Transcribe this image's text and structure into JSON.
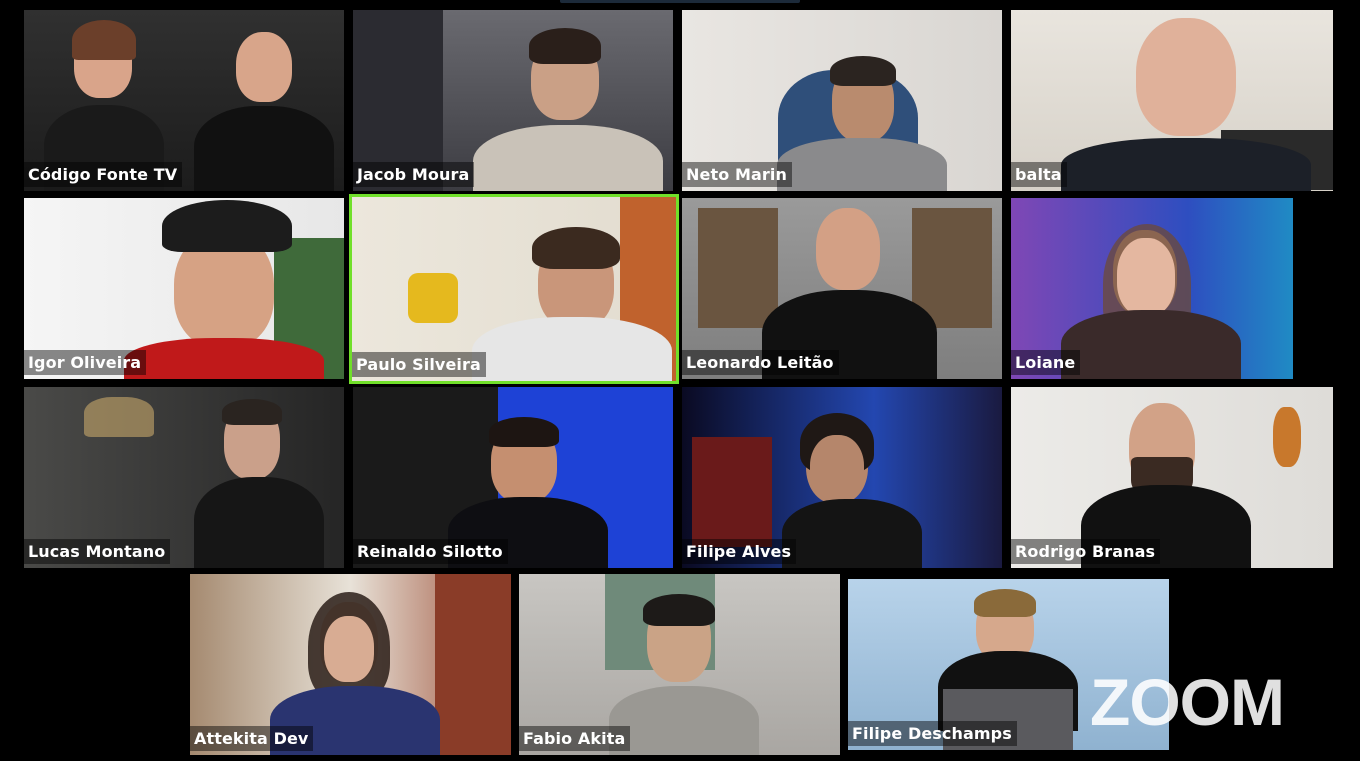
{
  "app": {
    "watermark": "zoom"
  },
  "participants": [
    {
      "name": "Código Fonte TV",
      "active": false,
      "bg": "#3a3a3a",
      "skin": "#d9a48a"
    },
    {
      "name": "Jacob Moura",
      "active": false,
      "bg": "#5b5b60",
      "skin": "#caa086"
    },
    {
      "name": "Neto Marin",
      "active": false,
      "bg": "#cfcfcf",
      "skin": "#b98b6e"
    },
    {
      "name": "balta",
      "active": false,
      "bg": "#e6e2dc",
      "skin": "#e0b19a"
    },
    {
      "name": "Igor Oliveira",
      "active": false,
      "bg": "#f0f0f0",
      "skin": "#d6a284"
    },
    {
      "name": "Paulo Silveira",
      "active": true,
      "bg": "#eae6dd",
      "skin": "#c9967a"
    },
    {
      "name": "Leonardo Leitão",
      "active": false,
      "bg": "#8a8a8a",
      "skin": "#d3a085"
    },
    {
      "name": "Loiane",
      "active": false,
      "bg": "#2e3a7a",
      "skin": "#e4b7a0"
    },
    {
      "name": "Lucas Montano",
      "active": false,
      "bg": "#2c2c2c",
      "skin": "#caa08a"
    },
    {
      "name": "Reinaldo Silotto",
      "active": false,
      "bg": "#1c3fd0",
      "skin": "#c58f70"
    },
    {
      "name": "Filipe Alves",
      "active": false,
      "bg": "#10103a",
      "skin": "#b5866b"
    },
    {
      "name": "Rodrigo Branas",
      "active": false,
      "bg": "#e5e3df",
      "skin": "#d2a287"
    },
    {
      "name": "Attekita Dev",
      "active": false,
      "bg": "#7a5a45",
      "skin": "#d8ac93"
    },
    {
      "name": "Fabio Akita",
      "active": false,
      "bg": "#b9b6b1",
      "skin": "#caa386"
    },
    {
      "name": "Filipe Deschamps",
      "active": false,
      "bg": "#a8c6e0",
      "skin": "#d6a88c"
    }
  ]
}
